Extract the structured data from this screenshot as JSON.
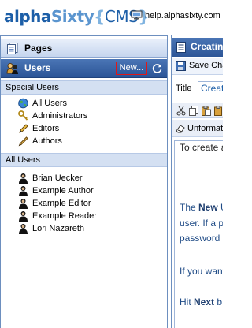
{
  "header": {
    "logo": {
      "part1": "alpha",
      "part2": "Sixty",
      "part3": "{",
      "part4": "CMS",
      "part5": "}"
    },
    "site_link": "help.alphasixty.com"
  },
  "sidebar": {
    "pages_label": "Pages",
    "users_label": "Users",
    "new_button": "New...",
    "special_header": "Special Users",
    "special_items": [
      {
        "label": "All Users",
        "icon": "globe-icon"
      },
      {
        "label": "Administrators",
        "icon": "key-icon"
      },
      {
        "label": "Editors",
        "icon": "pencil-icon"
      },
      {
        "label": "Authors",
        "icon": "pen-icon"
      }
    ],
    "all_header": "All Users",
    "users": [
      {
        "label": "Brian Uecker",
        "icon": "user-icon"
      },
      {
        "label": "Example Author",
        "icon": "user-icon"
      },
      {
        "label": "Example Editor",
        "icon": "user-icon"
      },
      {
        "label": "Example Reader",
        "icon": "user-icon"
      },
      {
        "label": "Lori Nazareth",
        "icon": "user-icon"
      }
    ]
  },
  "editor": {
    "title_bar": "Creatin",
    "save_label": "Save Cha",
    "title_field_label": "Title",
    "title_field_value": "Creati",
    "format_label": "Unformat",
    "body": {
      "line1": "To create a",
      "line2_bold": "New",
      "line2_rest": " U",
      "line3": "user. If a p",
      "line4": "password",
      "line5": "If you want",
      "line6_pre": "Hit ",
      "line6_bold": "Next",
      "line6_post": " b"
    }
  },
  "colors": {
    "accent_blue": "#2c5597",
    "new_button_border": "#e01818",
    "section_header_bg": "#d4e0f2"
  }
}
